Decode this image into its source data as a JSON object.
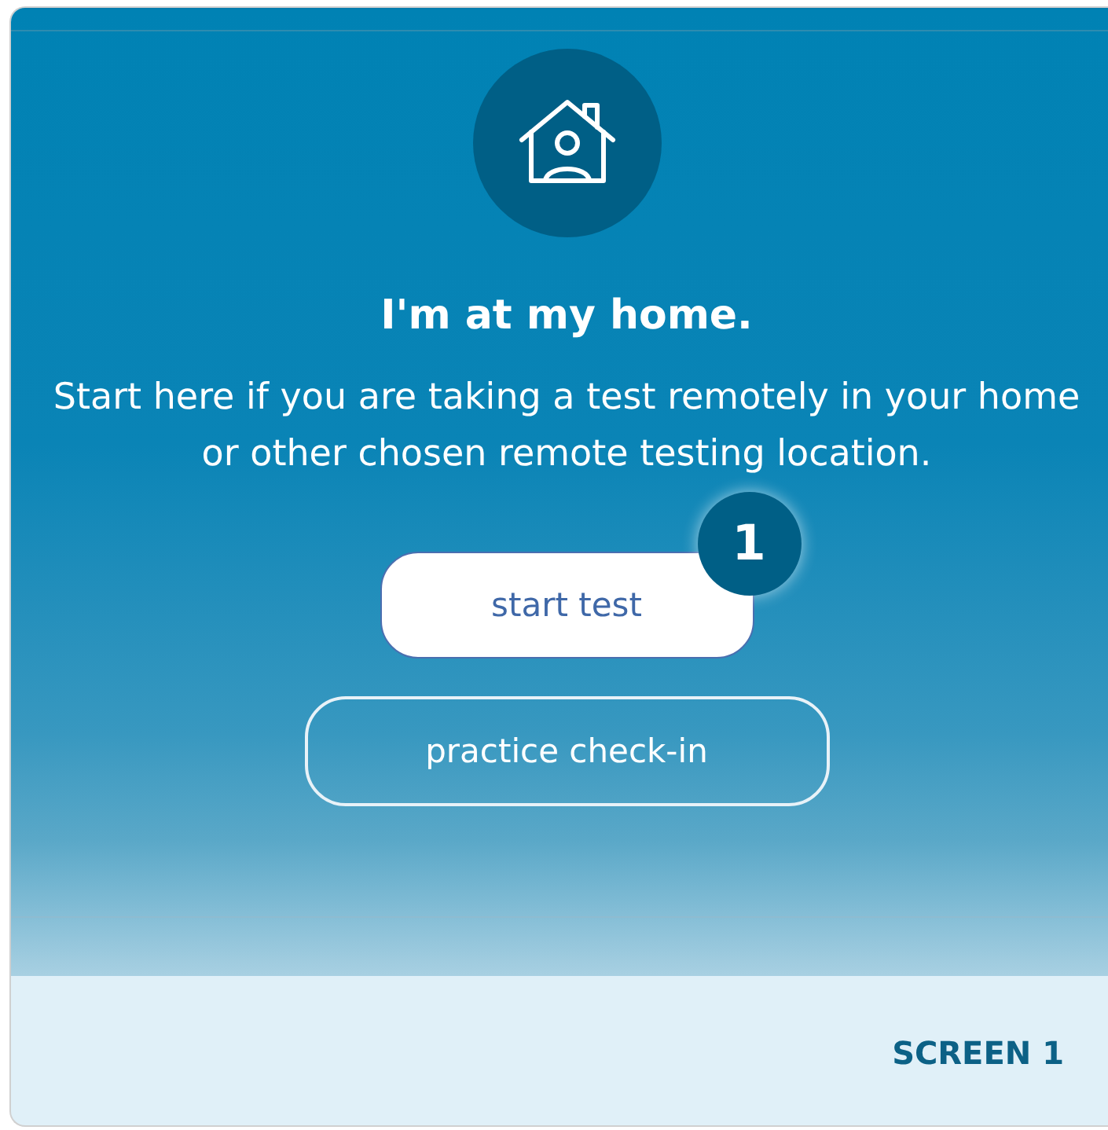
{
  "heading": "I'm at my home.",
  "description": "Start here if you are taking a test remotely in your home or other chosen remote testing location.",
  "buttons": [
    {
      "kind": "primary",
      "label": "start test",
      "badge": "1"
    },
    {
      "kind": "outline",
      "label": "practice check-in"
    }
  ],
  "footer": {
    "label": "SCREEN 1"
  }
}
